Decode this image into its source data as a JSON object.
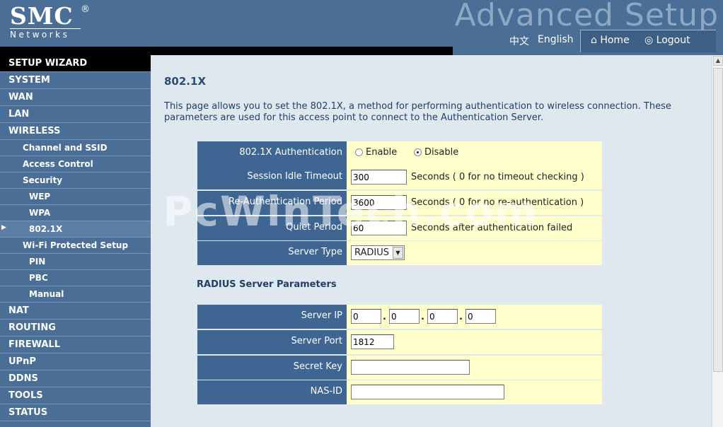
{
  "header": {
    "logo_main": "SMC",
    "logo_reg": "®",
    "logo_sub": "Networks",
    "banner": "Advanced Setup",
    "lang_zh": "中文",
    "lang_en": "English",
    "home": "Home",
    "logout": "Logout"
  },
  "sidebar": {
    "setup_wizard": "SETUP WIZARD",
    "system": "SYSTEM",
    "wan": "WAN",
    "lan": "LAN",
    "wireless": "WIRELESS",
    "channel_ssid": "Channel and SSID",
    "access_control": "Access Control",
    "security": "Security",
    "wep": "WEP",
    "wpa": "WPA",
    "dot1x": "802.1X",
    "wps": "Wi-Fi Protected Setup",
    "pin": "PIN",
    "pbc": "PBC",
    "manual": "Manual",
    "nat": "NAT",
    "routing": "ROUTING",
    "firewall": "FIREWALL",
    "upnp": "UPnP",
    "ddns": "DDNS",
    "tools": "TOOLS",
    "status": "STATUS"
  },
  "main": {
    "title": "802.1X",
    "description": "This page allows you to set the 802.1X, a method for performing authentication to wireless connection. These parameters are used for this access point to connect to the Authentication Server.",
    "auth_label": "802.1X Authentication",
    "enable": "Enable",
    "disable": "Disable",
    "idle_label": "Session Idle Timeout",
    "idle_value": "300",
    "idle_unit": "Seconds ( 0 for no timeout checking )",
    "reauth_label": "Re-Authentication Period",
    "reauth_value": "3600",
    "reauth_unit": "Seconds ( 0 for no re-authentication )",
    "quiet_label": "Quiet Period",
    "quiet_value": "60",
    "quiet_unit": "Seconds after authentication failed",
    "server_type_label": "Server Type",
    "server_type_value": "RADIUS",
    "radius_title": "RADIUS Server Parameters",
    "server_ip_label": "Server IP",
    "ip1": "0",
    "ip2": "0",
    "ip3": "0",
    "ip4": "0",
    "server_port_label": "Server Port",
    "server_port_value": "1812",
    "secret_key_label": "Secret Key",
    "secret_key_value": "",
    "nas_id_label": "NAS-ID",
    "nas_id_value": ""
  },
  "watermark": "PcWinTech.com"
}
